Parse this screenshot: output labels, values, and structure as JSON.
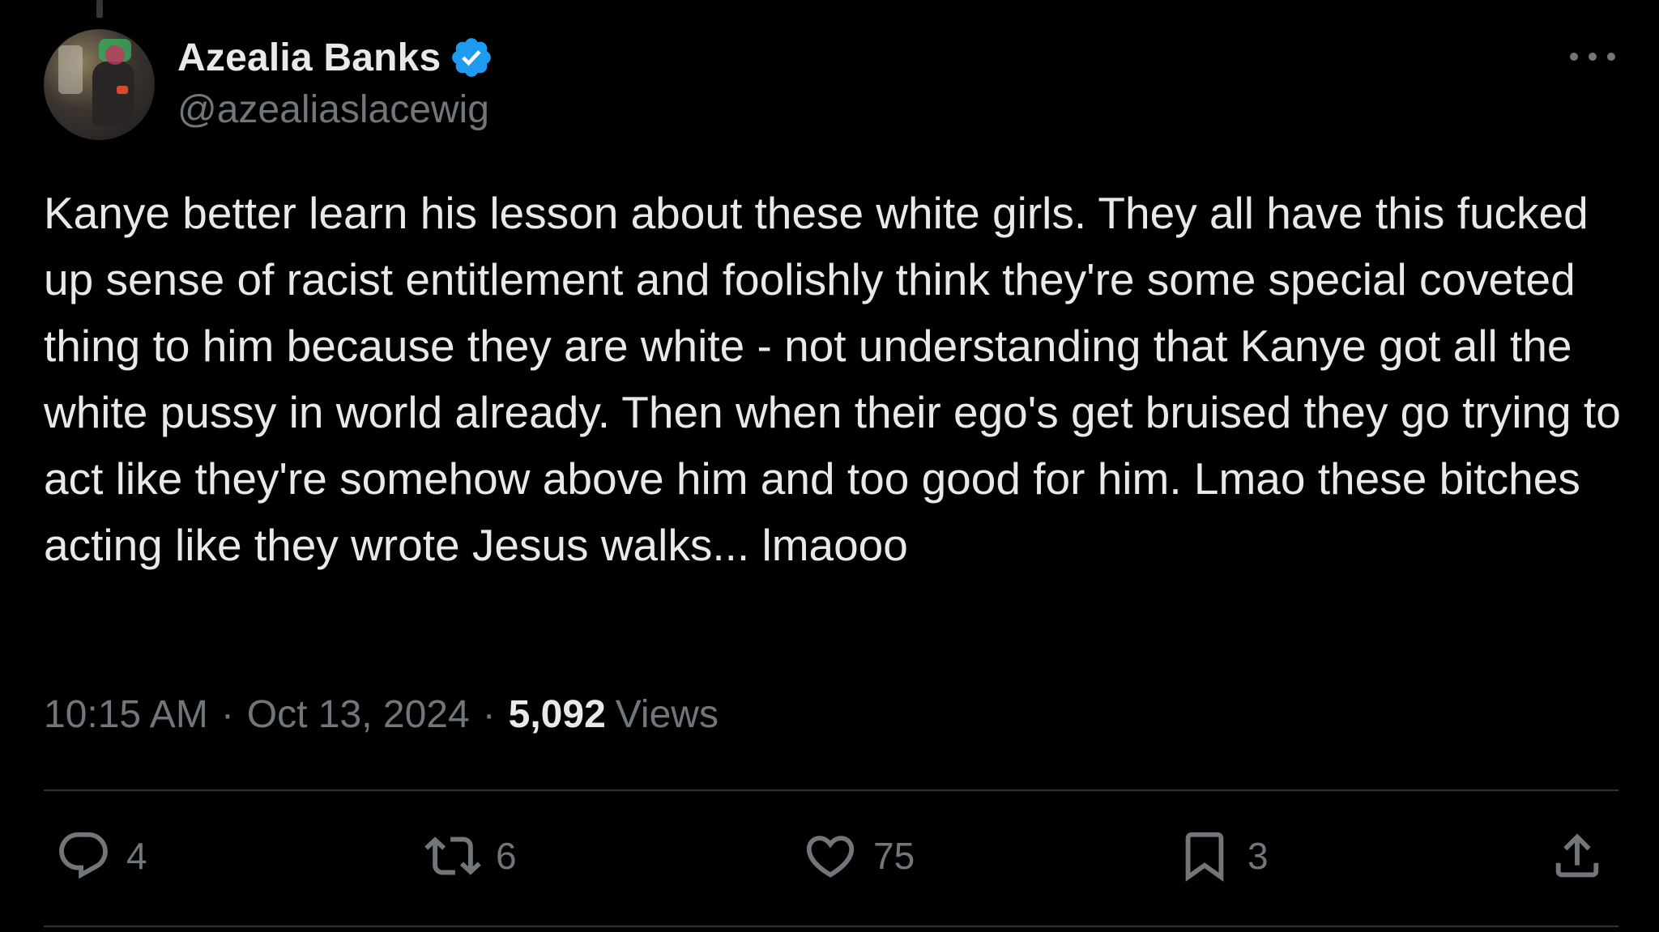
{
  "author": {
    "display_name": "Azealia Banks",
    "handle": "@azealiaslacewig",
    "verified": true
  },
  "tweet": {
    "text": "Kanye better learn his lesson about these white girls. They all have this fucked up sense of racist entitlement and foolishly think they're some special coveted thing to him because they are white - not understanding that Kanye got all the white pussy in world already. Then when their ego's get bruised they go trying to act like they're somehow above him and too good for him. Lmao these bitches acting like they wrote Jesus walks... lmaooo"
  },
  "meta": {
    "time": "10:15 AM",
    "separator": "·",
    "date": "Oct 13, 2024",
    "views_count": "5,092",
    "views_label": "Views"
  },
  "actions": {
    "replies": "4",
    "reposts": "6",
    "likes": "75",
    "bookmarks": "3"
  },
  "icons": {
    "reply": "reply-icon",
    "repost": "repost-icon",
    "like": "heart-icon",
    "bookmark": "bookmark-icon",
    "share": "share-icon",
    "more": "more-dots-icon",
    "verified": "verified-badge-icon"
  },
  "colors": {
    "background": "#000000",
    "text_primary": "#e7e9ea",
    "text_secondary": "#71767b",
    "verified_blue": "#1d9bf0",
    "divider": "#2f3336"
  }
}
